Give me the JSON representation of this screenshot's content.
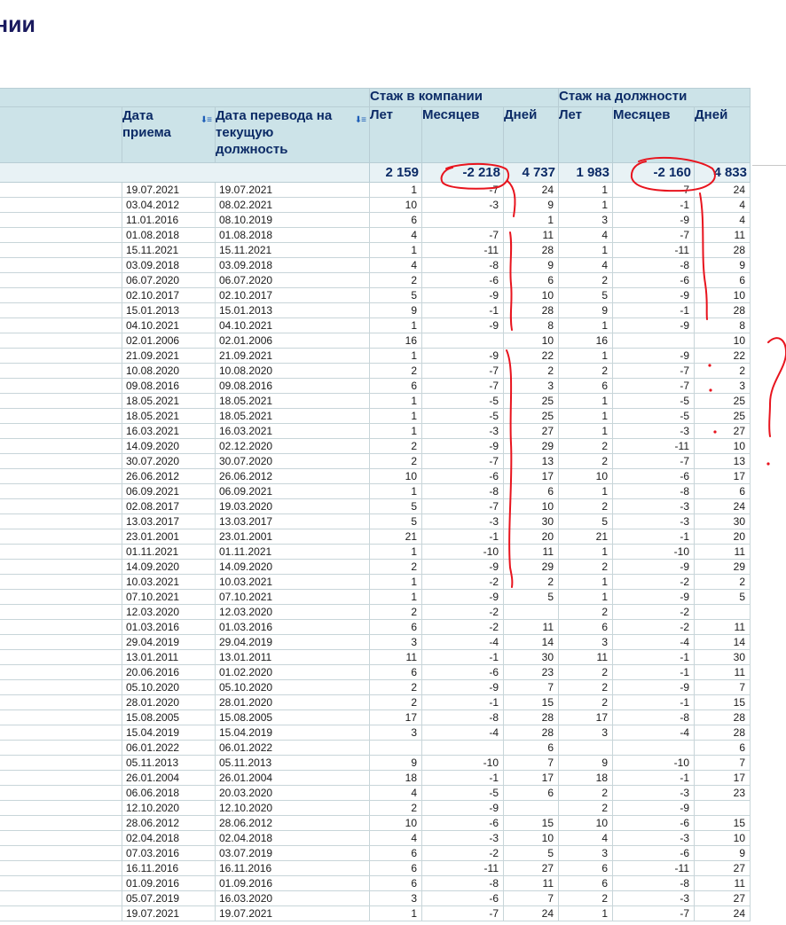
{
  "page": {
    "title_fragment": "нии"
  },
  "table": {
    "group_headers": {
      "company": "Стаж в компании",
      "position": "Стаж на должности"
    },
    "col_headers": {
      "hire_date": "Дата приема",
      "transfer_date": "Дата перевода на текущую должность",
      "company_years": "Лет",
      "company_months": "Месяцев",
      "company_days": "Дней",
      "position_years": "Лет",
      "position_months": "Месяцев",
      "position_days": "Дней"
    },
    "sort_icons": [
      "sort-descending-icon",
      "sort-descending-icon"
    ],
    "totals": {
      "company_years": "2 159",
      "company_months": "-2 218",
      "company_days": "4 737",
      "position_years": "1 983",
      "position_months": "-2 160",
      "position_days": "4 833"
    },
    "rows": [
      [
        "19.07.2021",
        "19.07.2021",
        "1",
        "-7",
        "24",
        "1",
        "-7",
        "24"
      ],
      [
        "03.04.2012",
        "08.02.2021",
        "10",
        "-3",
        "9",
        "1",
        "-1",
        "4"
      ],
      [
        "11.01.2016",
        "08.10.2019",
        "6",
        "",
        "1",
        "3",
        "-9",
        "4"
      ],
      [
        "01.08.2018",
        "01.08.2018",
        "4",
        "-7",
        "11",
        "4",
        "-7",
        "11"
      ],
      [
        "15.11.2021",
        "15.11.2021",
        "1",
        "-11",
        "28",
        "1",
        "-11",
        "28"
      ],
      [
        "03.09.2018",
        "03.09.2018",
        "4",
        "-8",
        "9",
        "4",
        "-8",
        "9"
      ],
      [
        "06.07.2020",
        "06.07.2020",
        "2",
        "-6",
        "6",
        "2",
        "-6",
        "6"
      ],
      [
        "02.10.2017",
        "02.10.2017",
        "5",
        "-9",
        "10",
        "5",
        "-9",
        "10"
      ],
      [
        "15.01.2013",
        "15.01.2013",
        "9",
        "-1",
        "28",
        "9",
        "-1",
        "28"
      ],
      [
        "04.10.2021",
        "04.10.2021",
        "1",
        "-9",
        "8",
        "1",
        "-9",
        "8"
      ],
      [
        "02.01.2006",
        "02.01.2006",
        "16",
        "",
        "10",
        "16",
        "",
        "10"
      ],
      [
        "21.09.2021",
        "21.09.2021",
        "1",
        "-9",
        "22",
        "1",
        "-9",
        "22"
      ],
      [
        "10.08.2020",
        "10.08.2020",
        "2",
        "-7",
        "2",
        "2",
        "-7",
        "2"
      ],
      [
        "09.08.2016",
        "09.08.2016",
        "6",
        "-7",
        "3",
        "6",
        "-7",
        "3"
      ],
      [
        "18.05.2021",
        "18.05.2021",
        "1",
        "-5",
        "25",
        "1",
        "-5",
        "25"
      ],
      [
        "18.05.2021",
        "18.05.2021",
        "1",
        "-5",
        "25",
        "1",
        "-5",
        "25"
      ],
      [
        "16.03.2021",
        "16.03.2021",
        "1",
        "-3",
        "27",
        "1",
        "-3",
        "27"
      ],
      [
        "14.09.2020",
        "02.12.2020",
        "2",
        "-9",
        "29",
        "2",
        "-11",
        "10"
      ],
      [
        "30.07.2020",
        "30.07.2020",
        "2",
        "-7",
        "13",
        "2",
        "-7",
        "13"
      ],
      [
        "26.06.2012",
        "26.06.2012",
        "10",
        "-6",
        "17",
        "10",
        "-6",
        "17"
      ],
      [
        "06.09.2021",
        "06.09.2021",
        "1",
        "-8",
        "6",
        "1",
        "-8",
        "6"
      ],
      [
        "02.08.2017",
        "19.03.2020",
        "5",
        "-7",
        "10",
        "2",
        "-3",
        "24"
      ],
      [
        "13.03.2017",
        "13.03.2017",
        "5",
        "-3",
        "30",
        "5",
        "-3",
        "30"
      ],
      [
        "23.01.2001",
        "23.01.2001",
        "21",
        "-1",
        "20",
        "21",
        "-1",
        "20"
      ],
      [
        "01.11.2021",
        "01.11.2021",
        "1",
        "-10",
        "11",
        "1",
        "-10",
        "11"
      ],
      [
        "14.09.2020",
        "14.09.2020",
        "2",
        "-9",
        "29",
        "2",
        "-9",
        "29"
      ],
      [
        "10.03.2021",
        "10.03.2021",
        "1",
        "-2",
        "2",
        "1",
        "-2",
        "2"
      ],
      [
        "07.10.2021",
        "07.10.2021",
        "1",
        "-9",
        "5",
        "1",
        "-9",
        "5"
      ],
      [
        "12.03.2020",
        "12.03.2020",
        "2",
        "-2",
        "",
        "2",
        "-2",
        ""
      ],
      [
        "01.03.2016",
        "01.03.2016",
        "6",
        "-2",
        "11",
        "6",
        "-2",
        "11"
      ],
      [
        "29.04.2019",
        "29.04.2019",
        "3",
        "-4",
        "14",
        "3",
        "-4",
        "14"
      ],
      [
        "13.01.2011",
        "13.01.2011",
        "11",
        "-1",
        "30",
        "11",
        "-1",
        "30"
      ],
      [
        "20.06.2016",
        "01.02.2020",
        "6",
        "-6",
        "23",
        "2",
        "-1",
        "11"
      ],
      [
        "05.10.2020",
        "05.10.2020",
        "2",
        "-9",
        "7",
        "2",
        "-9",
        "7"
      ],
      [
        "28.01.2020",
        "28.01.2020",
        "2",
        "-1",
        "15",
        "2",
        "-1",
        "15"
      ],
      [
        "15.08.2005",
        "15.08.2005",
        "17",
        "-8",
        "28",
        "17",
        "-8",
        "28"
      ],
      [
        "15.04.2019",
        "15.04.2019",
        "3",
        "-4",
        "28",
        "3",
        "-4",
        "28"
      ],
      [
        "06.01.2022",
        "06.01.2022",
        "",
        "",
        "6",
        "",
        "",
        "6"
      ],
      [
        "05.11.2013",
        "05.11.2013",
        "9",
        "-10",
        "7",
        "9",
        "-10",
        "7"
      ],
      [
        "26.01.2004",
        "26.01.2004",
        "18",
        "-1",
        "17",
        "18",
        "-1",
        "17"
      ],
      [
        "06.06.2018",
        "20.03.2020",
        "4",
        "-5",
        "6",
        "2",
        "-3",
        "23"
      ],
      [
        "12.10.2020",
        "12.10.2020",
        "2",
        "-9",
        "",
        "2",
        "-9",
        ""
      ],
      [
        "28.06.2012",
        "28.06.2012",
        "10",
        "-6",
        "15",
        "10",
        "-6",
        "15"
      ],
      [
        "02.04.2018",
        "02.04.2018",
        "4",
        "-3",
        "10",
        "4",
        "-3",
        "10"
      ],
      [
        "07.03.2016",
        "03.07.2019",
        "6",
        "-2",
        "5",
        "3",
        "-6",
        "9"
      ],
      [
        "16.11.2016",
        "16.11.2016",
        "6",
        "-11",
        "27",
        "6",
        "-11",
        "27"
      ],
      [
        "01.09.2016",
        "01.09.2016",
        "6",
        "-8",
        "11",
        "6",
        "-8",
        "11"
      ],
      [
        "05.07.2019",
        "16.03.2020",
        "3",
        "-6",
        "7",
        "2",
        "-3",
        "27"
      ],
      [
        "19.07.2021",
        "19.07.2021",
        "1",
        "-7",
        "24",
        "1",
        "-7",
        "24"
      ]
    ]
  },
  "annotation": {
    "ink_color": "#e8141e",
    "marks": [
      "circle-around-company-months-total",
      "circle-around-position-months-total",
      "bracket-marks",
      "question-mark"
    ]
  }
}
